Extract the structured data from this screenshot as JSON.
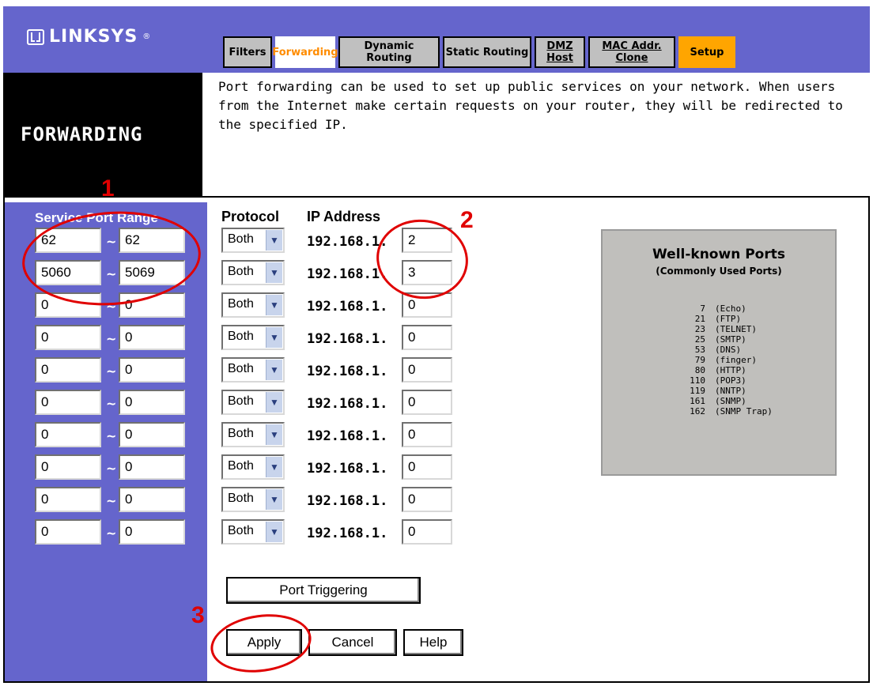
{
  "brand": "LINKSYS",
  "brand_mark": "®",
  "tabs": [
    {
      "label": "Filters",
      "underline": false
    },
    {
      "label": "Forwarding",
      "underline": false
    },
    {
      "label": "Dynamic Routing",
      "underline": false
    },
    {
      "label": "Static Routing",
      "underline": false
    },
    {
      "label": "DMZ Host",
      "underline": true
    },
    {
      "label": "MAC Addr. Clone",
      "underline": true
    },
    {
      "label": "Setup",
      "underline": false
    }
  ],
  "page_title": "FORWARDING",
  "description": "Port forwarding can be used to set up public services on your network. When users from the Internet make certain requests on your router, they will be redirected to the specified IP.",
  "columns": {
    "service_port_range": "Service Port Range",
    "protocol": "Protocol",
    "ip_address": "IP Address"
  },
  "ip_prefix": "192.168.1.",
  "tilde": "~",
  "rows": [
    {
      "start": "62",
      "end": "62",
      "protocol": "Both",
      "ip": "2"
    },
    {
      "start": "5060",
      "end": "5069",
      "protocol": "Both",
      "ip": "3"
    },
    {
      "start": "0",
      "end": "0",
      "protocol": "Both",
      "ip": "0"
    },
    {
      "start": "0",
      "end": "0",
      "protocol": "Both",
      "ip": "0"
    },
    {
      "start": "0",
      "end": "0",
      "protocol": "Both",
      "ip": "0"
    },
    {
      "start": "0",
      "end": "0",
      "protocol": "Both",
      "ip": "0"
    },
    {
      "start": "0",
      "end": "0",
      "protocol": "Both",
      "ip": "0"
    },
    {
      "start": "0",
      "end": "0",
      "protocol": "Both",
      "ip": "0"
    },
    {
      "start": "0",
      "end": "0",
      "protocol": "Both",
      "ip": "0"
    },
    {
      "start": "0",
      "end": "0",
      "protocol": "Both",
      "ip": "0"
    }
  ],
  "well_known": {
    "title": "Well-known Ports",
    "subtitle": "(Commonly Used Ports)",
    "ports": [
      {
        "num": "7",
        "name": "(Echo)"
      },
      {
        "num": "21",
        "name": "(FTP)"
      },
      {
        "num": "23",
        "name": "(TELNET)"
      },
      {
        "num": "25",
        "name": "(SMTP)"
      },
      {
        "num": "53",
        "name": "(DNS)"
      },
      {
        "num": "79",
        "name": "(finger)"
      },
      {
        "num": "80",
        "name": "(HTTP)"
      },
      {
        "num": "110",
        "name": "(POP3)"
      },
      {
        "num": "119",
        "name": "(NNTP)"
      },
      {
        "num": "161",
        "name": "(SNMP)"
      },
      {
        "num": "162",
        "name": "(SNMP Trap)"
      }
    ]
  },
  "buttons": {
    "port_triggering": "Port Triggering",
    "apply": "Apply",
    "cancel": "Cancel",
    "help": "Help"
  },
  "annotations": [
    "1",
    "2",
    "3"
  ],
  "colors": {
    "header_purple": "#6565cc",
    "active_tab_text": "#ff8c00",
    "setup_tab": "#ffa500",
    "annotation_red": "#e00000",
    "ports_panel": "#c0bfbc"
  }
}
